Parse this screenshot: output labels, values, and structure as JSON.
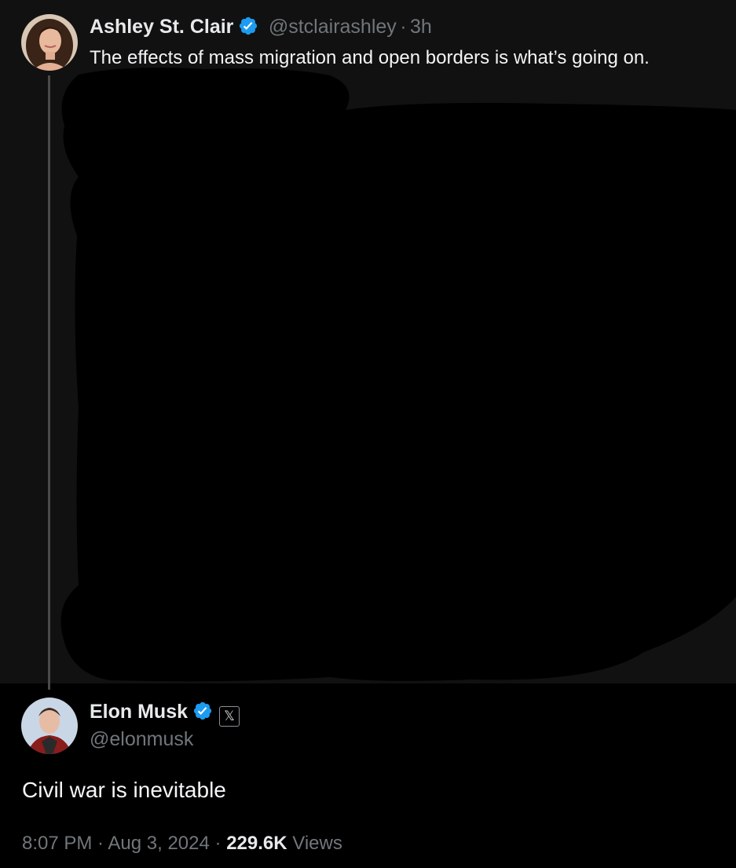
{
  "colors": {
    "background": "#000000",
    "thread_background": "#111111",
    "verified_blue": "#1d9bf0",
    "secondary_text": "#71767b",
    "primary_text": "#e7e9ea"
  },
  "quoted_post": {
    "author_name": "Ashley St. Clair",
    "verified_icon": "verified-badge-icon",
    "handle": "@stclairashley",
    "separator": "·",
    "time_ago": "3h",
    "text": "The effects of mass migration and open borders is what’s going on."
  },
  "main_post": {
    "author_name": "Elon Musk",
    "verified_icon": "verified-badge-icon",
    "affiliate_icon": "x-logo-icon",
    "affiliate_glyph": "𝕏",
    "handle": "@elonmusk",
    "text": "Civil war is inevitable",
    "time": "8:07 PM",
    "date": "Aug 3, 2024",
    "sep1": " · ",
    "sep2": " · ",
    "views_count": "229.6K",
    "views_label": "Views"
  }
}
